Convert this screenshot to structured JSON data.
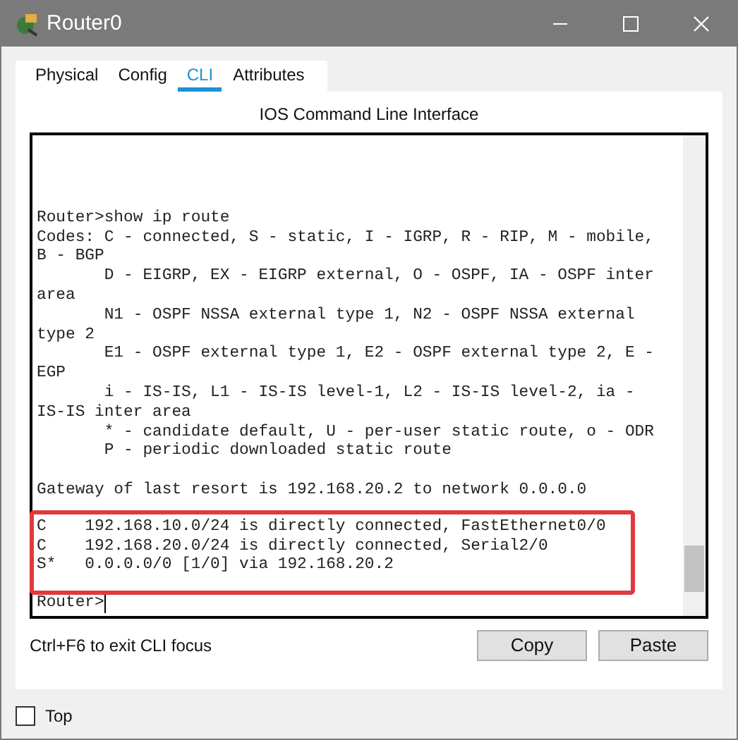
{
  "window": {
    "title": "Router0"
  },
  "tabs": [
    {
      "label": "Physical",
      "selected": false
    },
    {
      "label": "Config",
      "selected": false
    },
    {
      "label": "CLI",
      "selected": true
    },
    {
      "label": "Attributes",
      "selected": false
    }
  ],
  "heading": "IOS Command Line Interface",
  "console": {
    "lines": [
      "Router>show ip route",
      "Codes: C - connected, S - static, I - IGRP, R - RIP, M - mobile,",
      "B - BGP",
      "       D - EIGRP, EX - EIGRP external, O - OSPF, IA - OSPF inter",
      "area",
      "       N1 - OSPF NSSA external type 1, N2 - OSPF NSSA external",
      "type 2",
      "       E1 - OSPF external type 1, E2 - OSPF external type 2, E -",
      "EGP",
      "       i - IS-IS, L1 - IS-IS level-1, L2 - IS-IS level-2, ia -",
      "IS-IS inter area",
      "       * - candidate default, U - per-user static route, o - ODR",
      "       P - periodic downloaded static route"
    ],
    "gateway_line": "Gateway of last resort is 192.168.20.2 to network 0.0.0.0",
    "highlighted_routes": [
      "C    192.168.10.0/24 is directly connected, FastEthernet0/0",
      "C    192.168.20.0/24 is directly connected, Serial2/0",
      "S*   0.0.0.0/0 [1/0] via 192.168.20.2"
    ],
    "prompt": "Router>"
  },
  "hint": "Ctrl+F6 to exit CLI focus",
  "buttons": [
    "Copy",
    "Paste"
  ],
  "top_checkbox": {
    "label": "Top",
    "checked": false
  }
}
